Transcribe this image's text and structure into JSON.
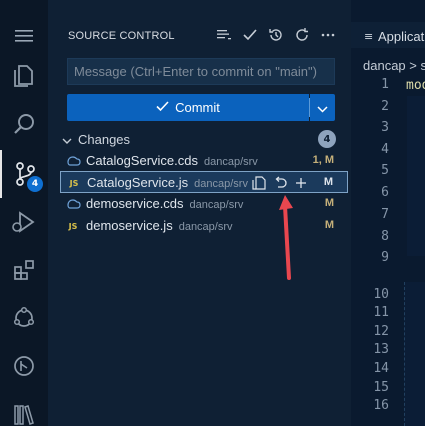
{
  "sidebar": {
    "title": "SOURCE CONTROL",
    "actions": [
      "view-as-tree-icon",
      "commit-check-icon",
      "history-icon",
      "refresh-icon",
      "more-icon"
    ],
    "message_placeholder": "Message (Ctrl+Enter to commit on \"main\")",
    "commit_label": "Commit",
    "changes_label": "Changes",
    "changes_count": "4",
    "files": [
      {
        "name": "CatalogService.cds",
        "path": "dancap/srv",
        "status": "1, M",
        "type": "cds"
      },
      {
        "name": "CatalogService.js",
        "path": "dancap/srv",
        "status": "M",
        "type": "js"
      },
      {
        "name": "demoservice.cds",
        "path": "dancap/srv",
        "status": "M",
        "type": "cds"
      },
      {
        "name": "demoservice.js",
        "path": "dancap/srv",
        "status": "M",
        "type": "js"
      }
    ]
  },
  "activity_bar": {
    "items": [
      "menu-icon",
      "explorer-icon",
      "search-icon",
      "source-control-icon",
      "run-debug-icon",
      "extensions-icon",
      "remote-icon",
      "timeline-icon",
      "library-icon"
    ],
    "scm_badge": "4"
  },
  "editor": {
    "tab_label": "Applicati",
    "breadcrumb": "dancap > s",
    "code_fragment": "mod",
    "line_numbers": [
      "1",
      "2",
      "3",
      "4",
      "5",
      "6",
      "7",
      "8",
      "9",
      "10",
      "11",
      "12",
      "13",
      "14",
      "15",
      "16"
    ]
  },
  "colors": {
    "accent": "#0b62bd",
    "arrow": "#e8474f",
    "status_modified": "#c5b07a"
  }
}
